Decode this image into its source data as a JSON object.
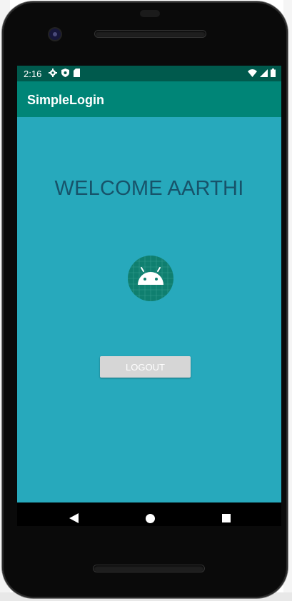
{
  "status_bar": {
    "time": "2:16",
    "icons_left": [
      "settings-icon",
      "shield-icon",
      "sd-card-icon"
    ],
    "icons_right": [
      "wifi-icon",
      "signal-icon",
      "battery-icon"
    ]
  },
  "app_bar": {
    "title": "SimpleLogin"
  },
  "main": {
    "welcome_text": "WELCOME AARTHI",
    "logo_icon": "android-launcher-icon",
    "logout_label": "LOGOUT"
  },
  "nav_bar": {
    "icons": [
      "back-icon",
      "home-icon",
      "recents-icon"
    ]
  },
  "colors": {
    "status_bar": "#005a4d",
    "app_bar": "#008577",
    "content_bg": "#27a9bc",
    "welcome_text": "#17536a",
    "button_bg": "#d6d6d6"
  }
}
